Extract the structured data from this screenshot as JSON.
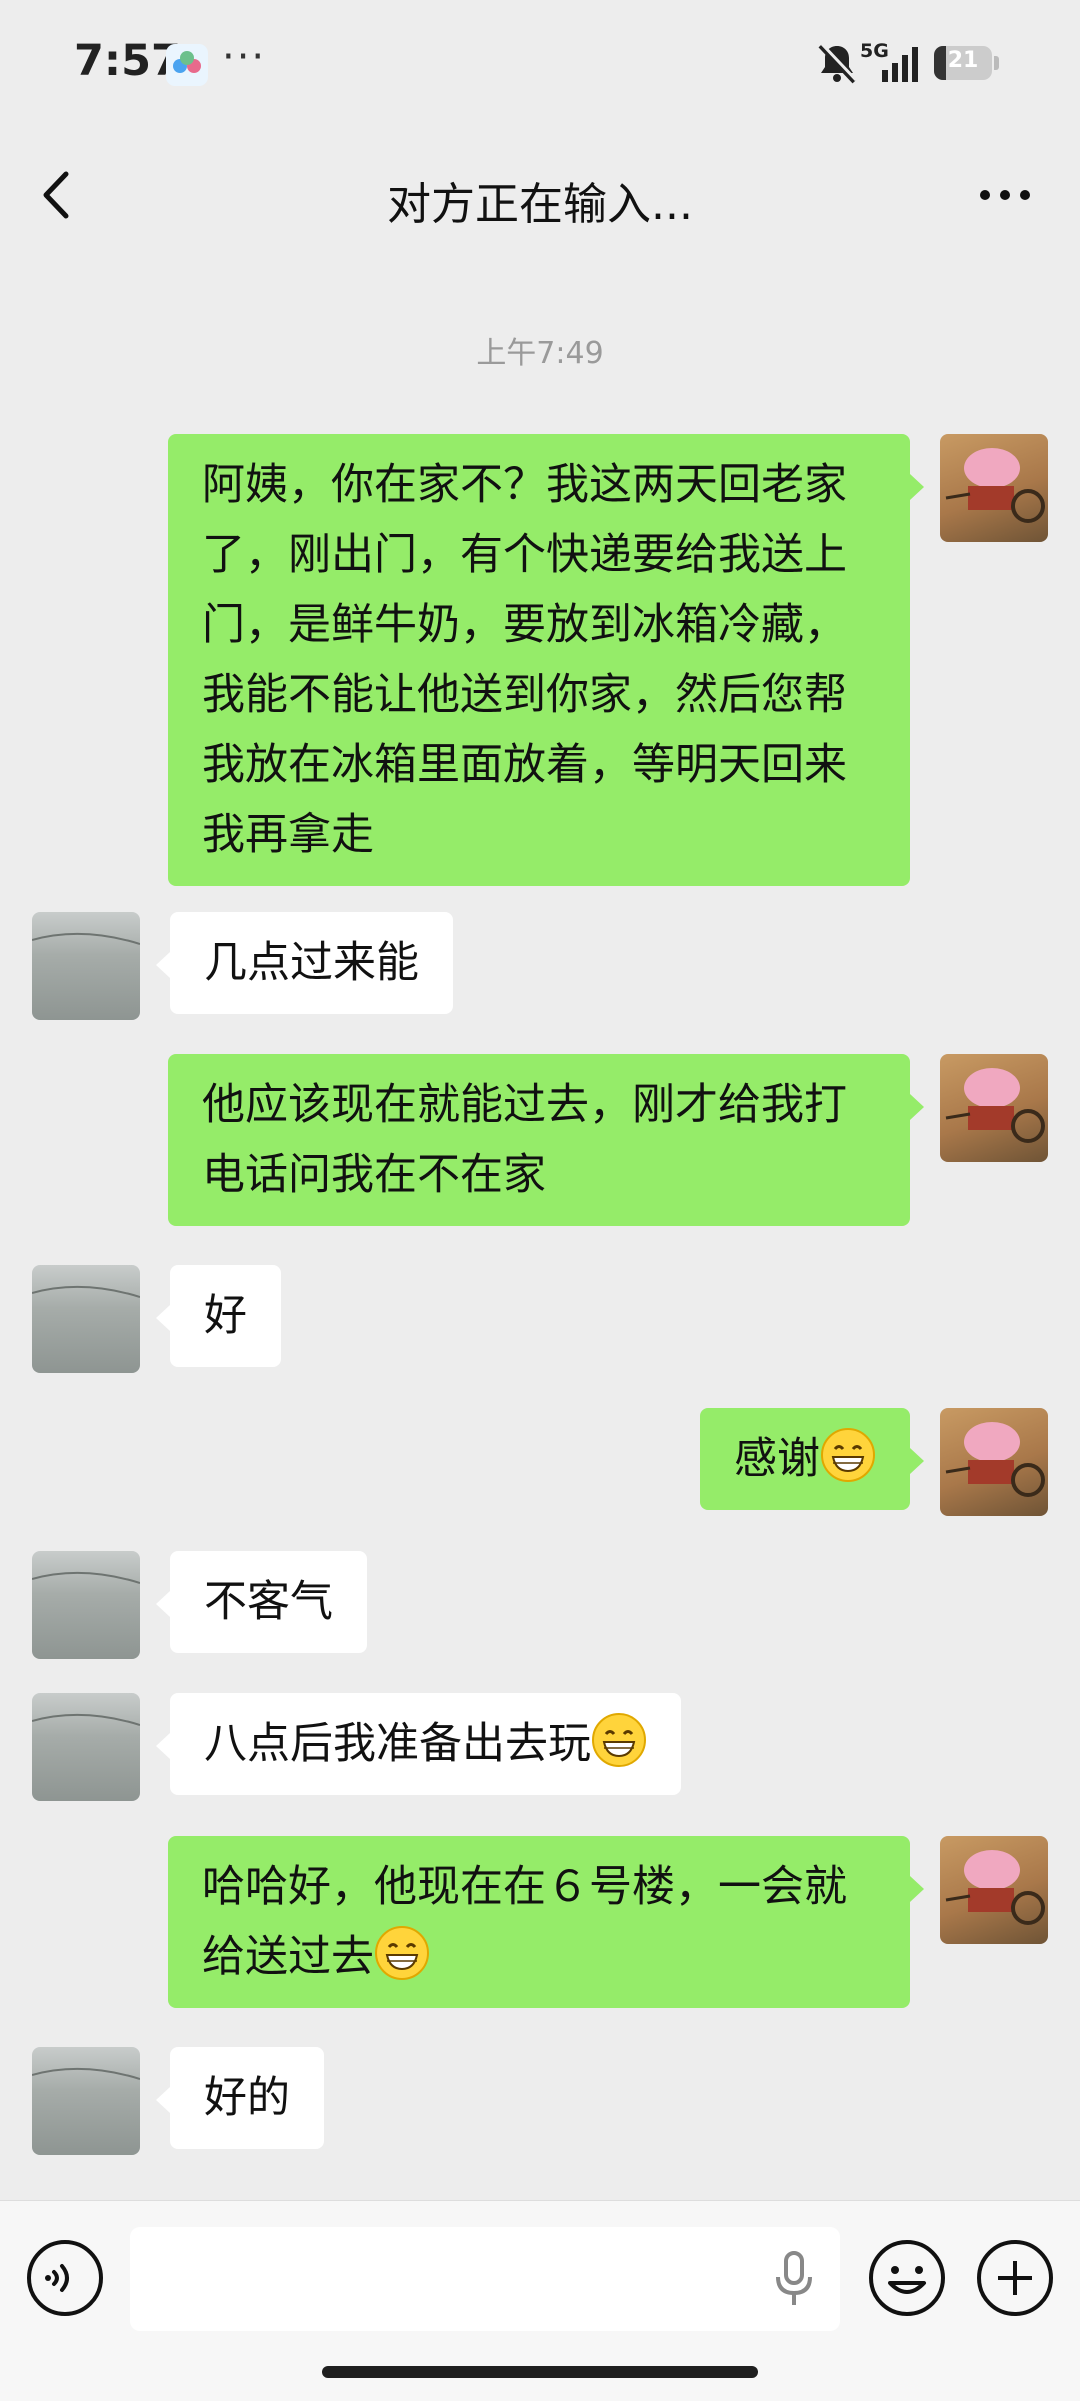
{
  "status_bar": {
    "time": "7:57",
    "more_dots": "···",
    "network": "5G",
    "battery_level": "21",
    "battery_fraction": 0.21
  },
  "header": {
    "title": "对方正在输入..."
  },
  "timestamp": "上午7:49",
  "messages": [
    {
      "side": "me",
      "text": "阿姨，你在家不？我这两天回老家\n了，刚出门，有个快递要给我送上\n门，是鲜牛奶，要放到冰箱冷藏，\n我能不能让他送到你家，然后您帮\n我放在冰箱里面放着，等明天回来\n我再拿走"
    },
    {
      "side": "them",
      "text": "几点过来能"
    },
    {
      "side": "me",
      "text": "他应该现在就能过去，刚才给我打\n电话问我在不在家"
    },
    {
      "side": "them",
      "text": "好"
    },
    {
      "side": "me",
      "text": "感谢",
      "emoji": "grin-emoji"
    },
    {
      "side": "them",
      "text": "不客气"
    },
    {
      "side": "them",
      "text": "八点后我准备出去玩",
      "emoji": "grin-emoji"
    },
    {
      "side": "me",
      "text": "哈哈好，他现在在６号楼，一会就\n给送过去",
      "emoji": "grin-emoji"
    },
    {
      "side": "them",
      "text": "好的"
    }
  ],
  "input_bar": {
    "value": "",
    "icons": [
      "voice-icon",
      "microphone-icon",
      "emoji-icon",
      "plus-icon"
    ]
  },
  "colors": {
    "me_bubble": "#95EC69",
    "them_bubble": "#FFFFFF",
    "background": "#EDEDED"
  }
}
